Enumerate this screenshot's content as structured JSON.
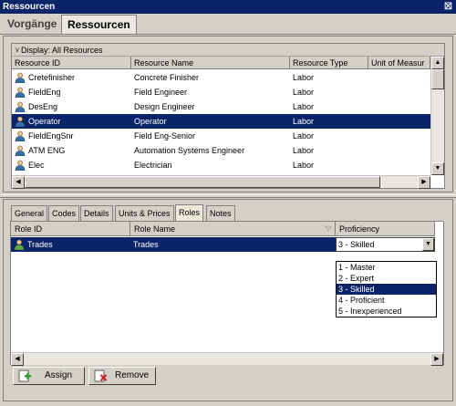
{
  "window": {
    "title": "Ressourcen",
    "close_glyph": "☒"
  },
  "top_tabs": [
    {
      "label": "Vorgänge",
      "active": false
    },
    {
      "label": "Ressourcen",
      "active": true
    }
  ],
  "resources": {
    "display_label": "Display: All Resources",
    "columns": [
      "Resource ID",
      "Resource Name",
      "Resource Type",
      "Unit of Measur"
    ],
    "rows": [
      {
        "id": "Cretefinisher",
        "name": "Concrete Finisher",
        "type": "Labor",
        "icon": "person-icon"
      },
      {
        "id": "FieldEng",
        "name": "Field Engineer",
        "type": "Labor",
        "icon": "person-icon"
      },
      {
        "id": "DesEng",
        "name": "Design Engineer",
        "type": "Labor",
        "icon": "person-icon"
      },
      {
        "id": "Operator",
        "name": "Operator",
        "type": "Labor",
        "icon": "person-icon",
        "selected": true
      },
      {
        "id": "FieldEngSnr",
        "name": "Field Eng-Senior",
        "type": "Labor",
        "icon": "person-icon"
      },
      {
        "id": "ATM ENG",
        "name": "Automation Systems Engineer",
        "type": "Labor",
        "icon": "person-icon"
      },
      {
        "id": "Elec",
        "name": "Electrician",
        "type": "Labor",
        "icon": "person-icon"
      }
    ]
  },
  "detail_tabs": [
    {
      "label": "General",
      "active": false
    },
    {
      "label": "Codes",
      "active": false
    },
    {
      "label": "Details",
      "active": false
    },
    {
      "label": "Units & Prices",
      "active": false
    },
    {
      "label": "Roles",
      "active": true
    },
    {
      "label": "Notes",
      "active": false
    }
  ],
  "roles": {
    "columns": [
      "Role ID",
      "Role Name",
      "Proficiency"
    ],
    "rows": [
      {
        "id": "Trades",
        "name": "Trades",
        "proficiency": "3 - Skilled",
        "icon": "role-icon"
      }
    ],
    "proficiency_options": [
      "1 - Master",
      "2 - Expert",
      "3 - Skilled",
      "4 - Proficient",
      "5 - Inexperienced"
    ],
    "selected_option": "3 - Skilled"
  },
  "actions": {
    "assign_label": "Assign",
    "remove_label": "Remove"
  },
  "colors": {
    "selection": "#0a246a",
    "title_bar": "#0a246a",
    "panel": "#d4d0c8"
  }
}
